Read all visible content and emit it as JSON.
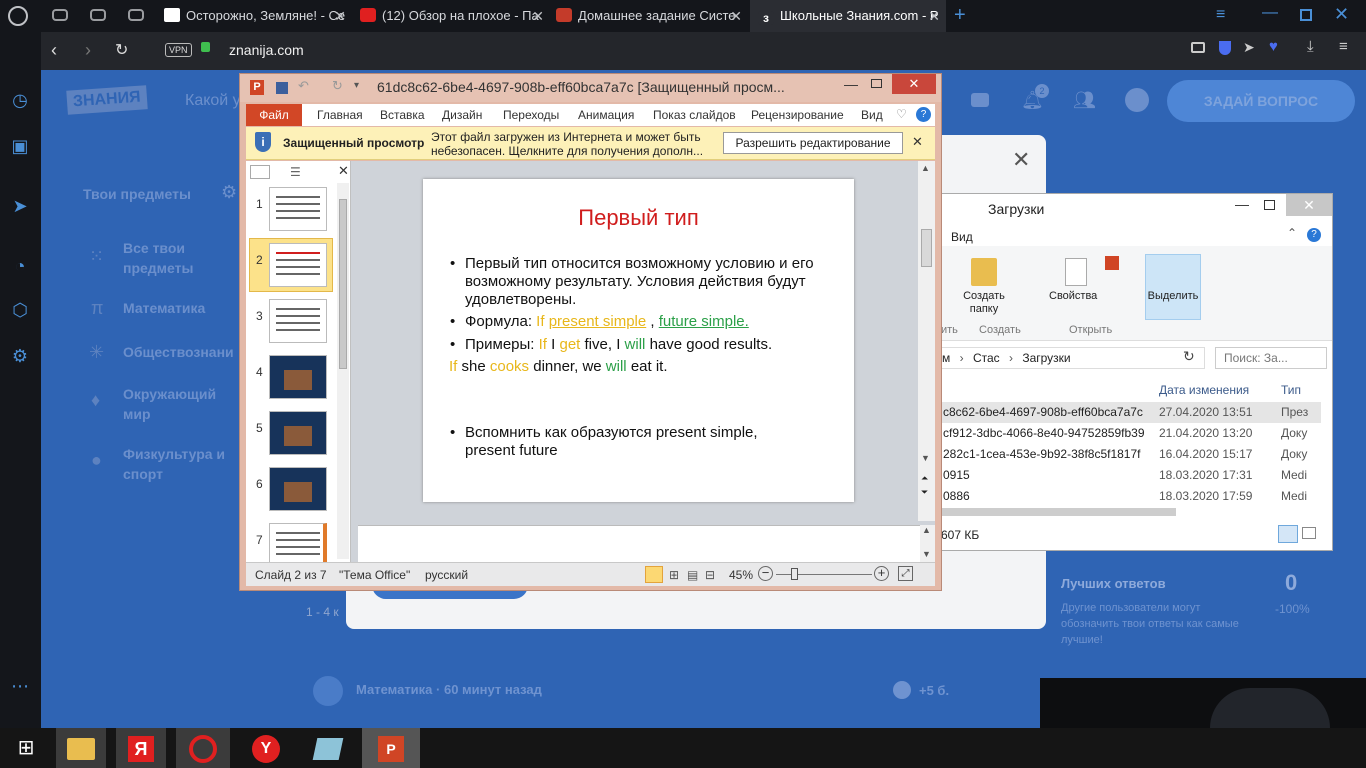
{
  "browser": {
    "tabs": [
      {
        "title": "Осторожно, Земляне! - Се"
      },
      {
        "title": "(12) Обзор на плохое - Па"
      },
      {
        "title": "Домашнее задание Систе"
      },
      {
        "title": "Школьные Знания.com - Р"
      }
    ],
    "vpn_label": "VPN",
    "url": "znanija.com"
  },
  "site": {
    "logo": "ЗНАНИЯ",
    "search_placeholder": "Какой у",
    "ask_button": "ЗАДАЙ ВОПРОС",
    "notif_count": "2",
    "subjects_title": "Твои предметы",
    "subjects": [
      {
        "label": "Все твои предметы"
      },
      {
        "label": "Математика"
      },
      {
        "label": "Обществознани"
      },
      {
        "label": "Окружающий мир"
      },
      {
        "label": "Физкультура и спорт"
      }
    ],
    "best_answers_label": "Лучших ответов",
    "best_answers_value": "0",
    "best_answers_pct": "-100%",
    "best_answers_note": "Другие пользователи могут обозначить твои ответы как самые лучшие!",
    "pagination": "1 - 4 к",
    "feed_item": "Математика · 60 минут назад",
    "feed_points": "+5 б."
  },
  "ppt": {
    "title": "61dc8c62-6be4-4697-908b-eff60bca7a7c [Защищенный просм...",
    "app_letter": "P",
    "tabs": [
      "Файл",
      "Главная",
      "Вставка",
      "Дизайн",
      "Переходы",
      "Анимация",
      "Показ слайдов",
      "Рецензирование",
      "Вид"
    ],
    "protected_title": "Защищенный просмотр",
    "protected_msg_1": "Этот файл загружен из Интернета и может быть",
    "protected_msg_2": "небезопасен. Щелкните для получения дополн...",
    "enable_edit": "Разрешить редактирование",
    "thumb_numbers": [
      "1",
      "2",
      "3",
      "4",
      "5",
      "6",
      "7"
    ],
    "slide": {
      "title": "Первый тип",
      "b1": "Первый тип относится возможному условию и его возможному результату. Условия действия будут удовлетворены.",
      "formula_label": "Формула: ",
      "formula_if": "If",
      "formula_ps": "present simple",
      "formula_comma": " ,",
      "formula_fs": "future simple.",
      "examples_label": "Примеры: ",
      "ex1_if": "If",
      "ex1_i": "I",
      "ex1_get": "get",
      "ex1_five": "five, I",
      "ex1_will": "will",
      "ex1_rest": "have good results.",
      "ex2_if": "If",
      "ex2_she": "she",
      "ex2_cooks": "cooks",
      "ex2_mid": "dinner, we",
      "ex2_will": "will",
      "ex2_rest": "eat it.",
      "b4": "Вспомнить как образуются present simple, present future"
    },
    "status": {
      "slide_of": "Слайд 2 из 7",
      "theme": "\"Тема Office\"",
      "lang": "русский",
      "zoom": "45%"
    },
    "zoom_level": 0.45,
    "selected_thumb": 2
  },
  "explorer": {
    "title": "Загрузки",
    "menu_view": "Вид",
    "ribbon": {
      "new_folder": "Создать папку",
      "properties": "Свойства",
      "select": "Выделить",
      "group_create": "Создать",
      "group_open": "Открыть",
      "group_cut": "ить"
    },
    "path": [
      "м",
      "Стас",
      "Загрузки"
    ],
    "search_placeholder": "Поиск: За...",
    "columns": {
      "date": "Дата изменения",
      "type": "Тип"
    },
    "files": [
      {
        "name": "c8c62-6be4-4697-908b-eff60bca7a7c",
        "date": "27.04.2020 13:51",
        "type": "През"
      },
      {
        "name": "cf912-3dbc-4066-8e40-94752859fb39",
        "date": "21.04.2020 13:20",
        "type": "Доку"
      },
      {
        "name": "282c1-1cea-453e-9b92-38f8c5f1817f",
        "date": "16.04.2020 15:17",
        "type": "Доку"
      },
      {
        "name": "0915",
        "date": "18.03.2020 17:31",
        "type": "Medi"
      },
      {
        "name": "0886",
        "date": "18.03.2020 17:59",
        "type": "Medi"
      }
    ],
    "status_size": "607 КБ"
  }
}
